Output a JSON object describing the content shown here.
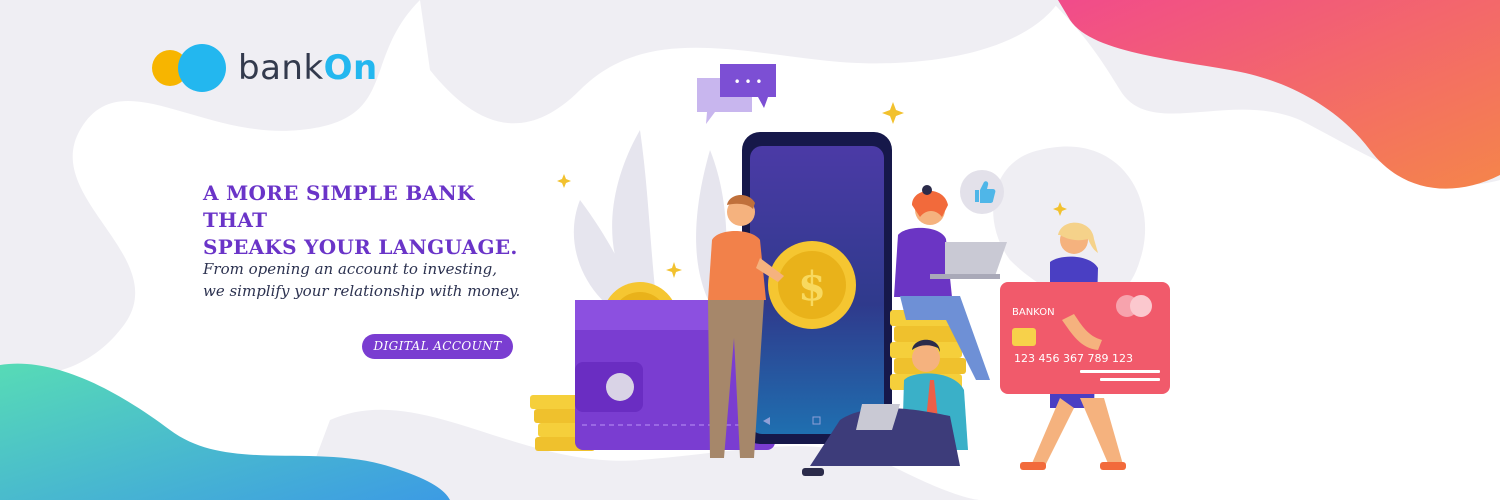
{
  "brand": {
    "name_prefix": "bank",
    "name_suffix": "On"
  },
  "hero": {
    "headline_line1": "A MORE SIMPLE BANK THAT",
    "headline_line2": "SPEAKS YOUR LANGUAGE.",
    "sub_line1": "From opening an account to investing,",
    "sub_line2": "we simplify your relationship with money.",
    "cta_label": "DIGITAL ACCOUNT"
  },
  "card": {
    "brand": "BANKON",
    "number": "123 456 367 789 123"
  },
  "chat_bubble": {
    "text": "• • •"
  },
  "colors": {
    "accent": "#7a3dd1",
    "headline": "#6a34c8",
    "logo_blue": "#23b7ef",
    "logo_yellow": "#f7b500",
    "blob_top_right_start": "#f14b8b",
    "blob_top_right_end": "#f5854a",
    "blob_bottom_left_start": "#57dbb6",
    "blob_bottom_left_end": "#3c9be4",
    "card": "#f15a6b"
  },
  "icons": [
    "logo-mark-icon",
    "chat-bubble-icon",
    "thumbs-up-icon",
    "sparkle-icon",
    "coin-icon",
    "wallet-icon",
    "smartphone-icon",
    "credit-card-icon",
    "laptop-icon"
  ]
}
